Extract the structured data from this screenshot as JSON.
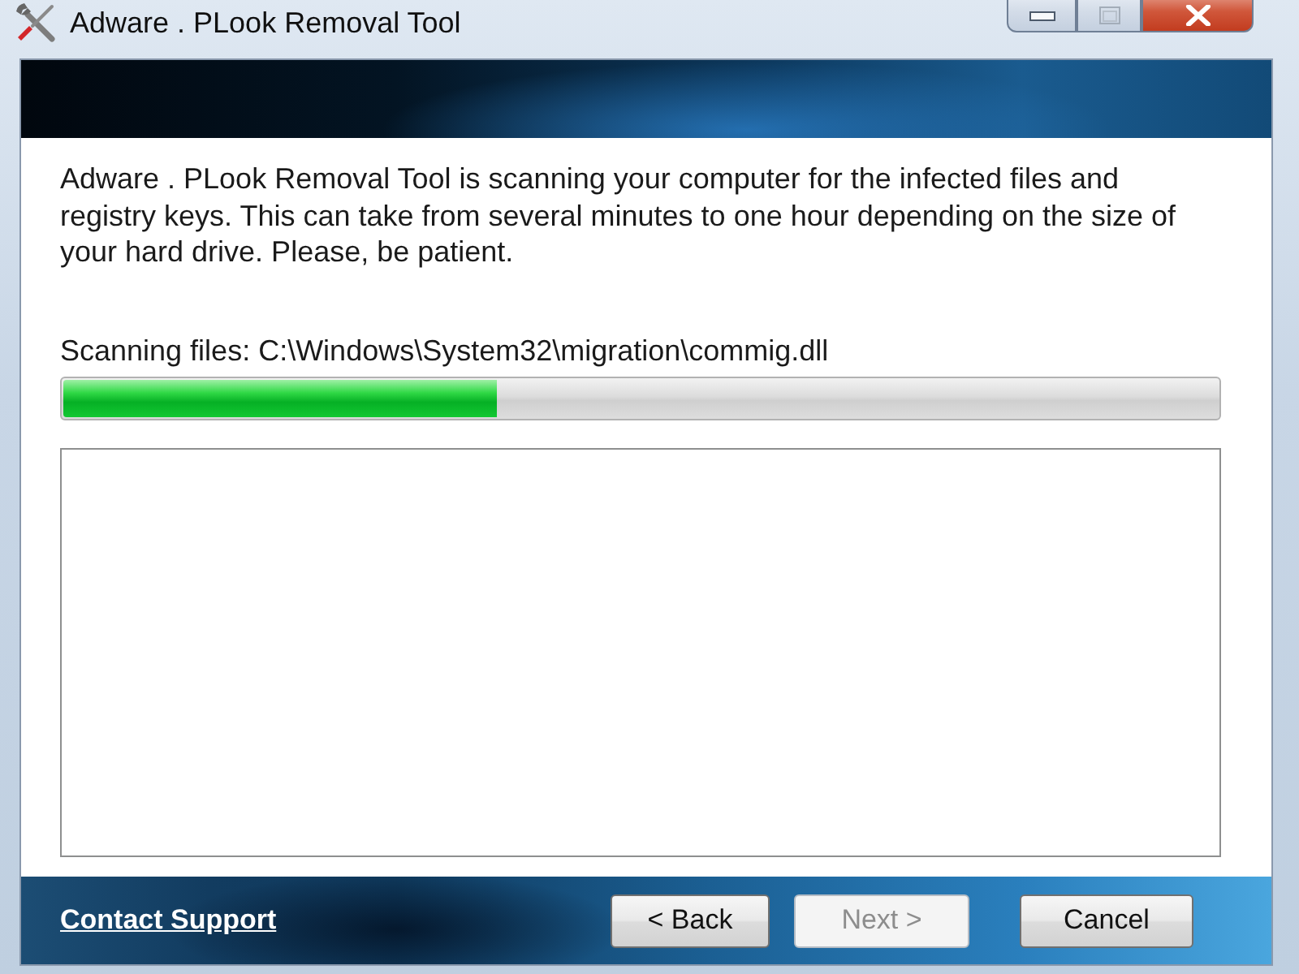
{
  "window": {
    "title": "Adware . PLook Removal Tool"
  },
  "message": "Adware . PLook Removal Tool is scanning your computer for the infected files and registry keys. This can take from several minutes to one hour depending on the size of your hard drive. Please, be patient.",
  "scan": {
    "label": "Scanning files: C:\\Windows\\System32\\migration\\commig.dll",
    "level": 0.375
  },
  "footer": {
    "link": "Contact Support",
    "buttons": [
      {
        "label": "< Back",
        "disabled": false
      },
      {
        "label": "Next >",
        "disabled": true
      },
      {
        "label": "Cancel",
        "disabled": false
      }
    ]
  }
}
